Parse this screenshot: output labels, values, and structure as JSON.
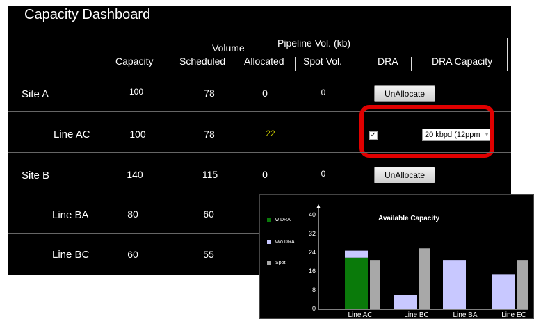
{
  "app": {
    "title": "Capacity Dashboard"
  },
  "table": {
    "headers": {
      "capacity": "Capacity",
      "volume": "Volume",
      "scheduled": "Scheduled",
      "pipeline": "Pipeline Vol. (kb)",
      "allocated": "Allocated",
      "spot": "Spot Vol.",
      "dra": "DRA",
      "dra_capacity": "DRA Capacity"
    },
    "rows": [
      {
        "label": "Site A",
        "capacity": "100",
        "scheduled": "78",
        "allocated": "0",
        "spot": "0",
        "action": "UnAllocate"
      },
      {
        "label": "Line AC",
        "capacity": "100",
        "scheduled": "78",
        "allocated": "22",
        "checked": "✓",
        "dra_select": "20 kbpd (12ppm"
      },
      {
        "label": "Site B",
        "capacity": "140",
        "scheduled": "115",
        "allocated": "0",
        "spot": "0",
        "action": "UnAllocate"
      },
      {
        "label": "Line BA",
        "capacity": "80",
        "scheduled": "60"
      },
      {
        "label": "Line BC",
        "capacity": "60",
        "scheduled": "55"
      }
    ],
    "colors": {
      "allocated_highlight": "#c8c800",
      "highlight_box": "#e00000"
    }
  },
  "chart_data": {
    "type": "bar",
    "title": "Available Capacity",
    "categories": [
      "Line AC",
      "Line BC",
      "Line BA",
      "Line EC"
    ],
    "series": [
      {
        "name": "w DRA",
        "color": "#0a7a0a",
        "values": [
          22,
          0,
          0,
          0
        ],
        "stack": "main"
      },
      {
        "name": "w/o DRA",
        "color": "#c8c8ff",
        "values": [
          3,
          6,
          21,
          15
        ],
        "stack": "main"
      },
      {
        "name": "Spot",
        "color": "#a8a8a8",
        "values": [
          21,
          26,
          0,
          21
        ],
        "stack": "spot"
      }
    ],
    "yticks": [
      "40",
      "32",
      "24",
      "16",
      "8",
      "0"
    ],
    "ylim": [
      0,
      40
    ],
    "legend": "left"
  }
}
